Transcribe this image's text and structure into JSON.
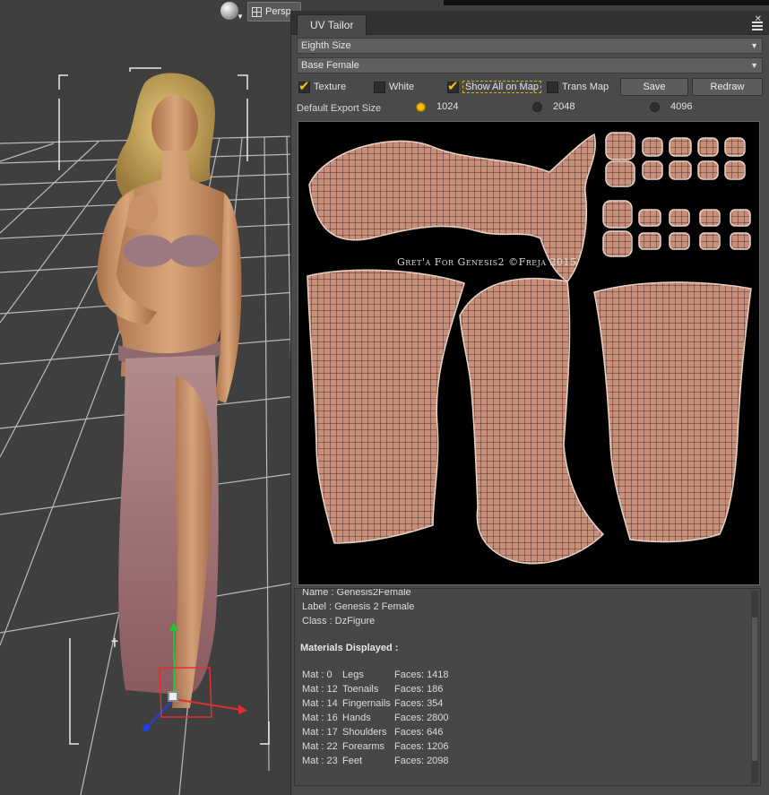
{
  "viewport": {
    "camera_label": "Persp",
    "sphere_icon": "render-sphere-icon",
    "camera_icon": "viewport-grid-icon"
  },
  "panel": {
    "tab_title": "UV Tailor",
    "close_glyph": "✕",
    "size_dropdown": "Eighth Size",
    "figure_dropdown": "Base Female",
    "dropdown_arrow": "▼",
    "options": {
      "texture": {
        "label": "Texture",
        "checked": true
      },
      "white": {
        "label": "White",
        "checked": false
      },
      "show_all": {
        "label": "Show All on Map",
        "checked": true
      },
      "trans_map": {
        "label": "Trans Map",
        "checked": false
      }
    },
    "save_label": "Save",
    "redraw_label": "Redraw",
    "export": {
      "label": "Default Export Size",
      "sizes": [
        {
          "label": "1024",
          "selected": true
        },
        {
          "label": "2048",
          "selected": false
        },
        {
          "label": "4096",
          "selected": false
        }
      ]
    },
    "uv_credit": "Gret'a For Genesis2 ©Freja 2015",
    "uv_fill_color": "#c8907a",
    "uv_line_color": "#2a1a14"
  },
  "info": {
    "name_line": "Name :  Genesis2Female",
    "label_line": "Label :  Genesis 2 Female",
    "class_line": "Class :  DzFigure",
    "materials_heading": "Materials Displayed :",
    "materials": [
      {
        "mat": "Mat :  0",
        "name": "Legs",
        "faces": "Faces: 1418"
      },
      {
        "mat": "Mat :  12",
        "name": "Toenails",
        "faces": "Faces: 186"
      },
      {
        "mat": "Mat :  14",
        "name": "Fingernails",
        "faces": "Faces: 354"
      },
      {
        "mat": "Mat :  16",
        "name": "Hands",
        "faces": "Faces: 2800"
      },
      {
        "mat": "Mat :  17",
        "name": "Shoulders",
        "faces": "Faces: 646"
      },
      {
        "mat": "Mat :  22",
        "name": "Forearms",
        "faces": "Faces: 1206"
      },
      {
        "mat": "Mat :  23",
        "name": "Feet",
        "faces": "Faces: 2098"
      }
    ]
  }
}
